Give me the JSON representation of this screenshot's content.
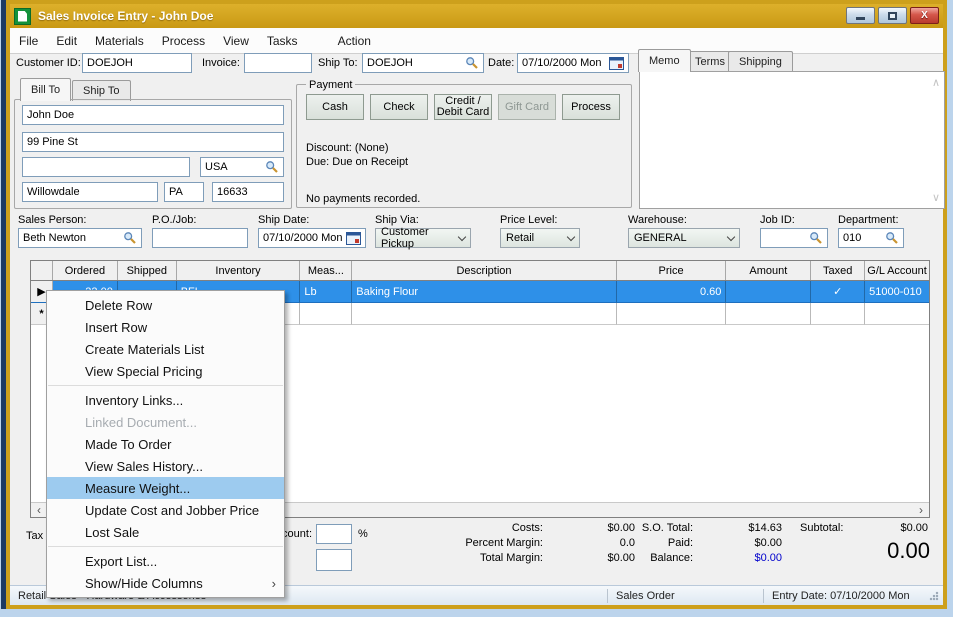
{
  "window": {
    "title": "Sales Invoice Entry - John Doe"
  },
  "menu_bar": {
    "items": [
      "File",
      "Edit",
      "Materials",
      "Process",
      "View",
      "Tasks",
      "Action"
    ]
  },
  "header_fields": {
    "customer_id_label": "Customer ID:",
    "customer_id": "DOEJOH",
    "invoice_label": "Invoice:",
    "invoice": "",
    "ship_to_label": "Ship To:",
    "ship_to": "DOEJOH",
    "date_label": "Date:",
    "date": "07/10/2000 Mon"
  },
  "address": {
    "tabs": [
      "Bill To",
      "Ship To"
    ],
    "name": "John Doe",
    "street": "99 Pine St",
    "line3": "",
    "country": "USA",
    "city": "Willowdale",
    "state": "PA",
    "zip": "16633"
  },
  "payment": {
    "title": "Payment",
    "buttons": [
      "Cash",
      "Check",
      "Credit / Debit Card",
      "Gift Card",
      "Process"
    ],
    "discount_line": "Discount: (None)",
    "due_line": "Due: Due on Receipt",
    "status_line": "No payments recorded."
  },
  "memo_panel": {
    "tabs": [
      "Memo",
      "Terms",
      "Shipping"
    ],
    "content": ""
  },
  "order_fields": {
    "sales_person_label": "Sales Person:",
    "sales_person": "Beth Newton",
    "po_job_label": "P.O./Job:",
    "po_job": "",
    "ship_date_label": "Ship Date:",
    "ship_date": "07/10/2000 Mon",
    "ship_via_label": "Ship Via:",
    "ship_via": "Customer Pickup",
    "price_level_label": "Price Level:",
    "price_level": "Retail",
    "warehouse_label": "Warehouse:",
    "warehouse": "GENERAL",
    "job_id_label": "Job ID:",
    "job_id": "",
    "department_label": "Department:",
    "department": "010"
  },
  "grid": {
    "columns": [
      "Ordered",
      "Shipped",
      "Inventory",
      "Meas...",
      "Description",
      "Price",
      "Amount",
      "Taxed",
      "G/L Account"
    ],
    "rows": [
      {
        "marker": "▶",
        "ordered": "22.00",
        "shipped": "",
        "inventory": "BFL",
        "meas": "Lb",
        "description": "Baking Flour",
        "price": "0.60",
        "amount": "",
        "taxed": "✓",
        "gl": "51000-010"
      },
      {
        "marker": "*",
        "ordered": "",
        "shipped": "",
        "inventory": "",
        "meas": "",
        "description": "",
        "price": "",
        "amount": "",
        "taxed": "",
        "gl": ""
      }
    ]
  },
  "context_menu": {
    "items": [
      "Delete Row",
      "Insert Row",
      "Create Materials List",
      "View Special Pricing",
      "Inventory Links...",
      "Linked Document...",
      "Made To Order",
      "View Sales History...",
      "Measure Weight...",
      "Update Cost and Jobber Price",
      "Lost Sale",
      "Export List...",
      "Show/Hide Columns"
    ],
    "submenu_arrow": "›"
  },
  "footer": {
    "tax_label": "Tax",
    "discount_label": "Discount:",
    "percent_sign": "%",
    "costs_label": "Costs:",
    "costs": "$0.00",
    "percent_margin_label": "Percent Margin:",
    "percent_margin": "0.0",
    "total_margin_label": "Total Margin:",
    "total_margin": "$0.00",
    "so_total_label": "S.O. Total:",
    "so_total": "$14.63",
    "paid_label": "Paid:",
    "paid": "$0.00",
    "balance_label": "Balance:",
    "balance": "$0.00",
    "subtotal_label": "Subtotal:",
    "subtotal": "$0.00",
    "grand_total": "0.00"
  },
  "status_bar": {
    "left": "Retail Sales - Hardware & Accessories",
    "middle": "Sales Order",
    "right": "Entry Date: 07/10/2000 Mon"
  },
  "icons": {
    "scroll_up": "∧",
    "scroll_down": "∨",
    "scroll_left": "‹",
    "scroll_right": "›",
    "close_glyph": "X"
  },
  "colors": {
    "titlebar_gold": "#CDA01C",
    "selected_row_blue": "#2E90E8",
    "menu_highlight_blue": "#9DCBEF",
    "balance_blue": "#0000CC"
  }
}
